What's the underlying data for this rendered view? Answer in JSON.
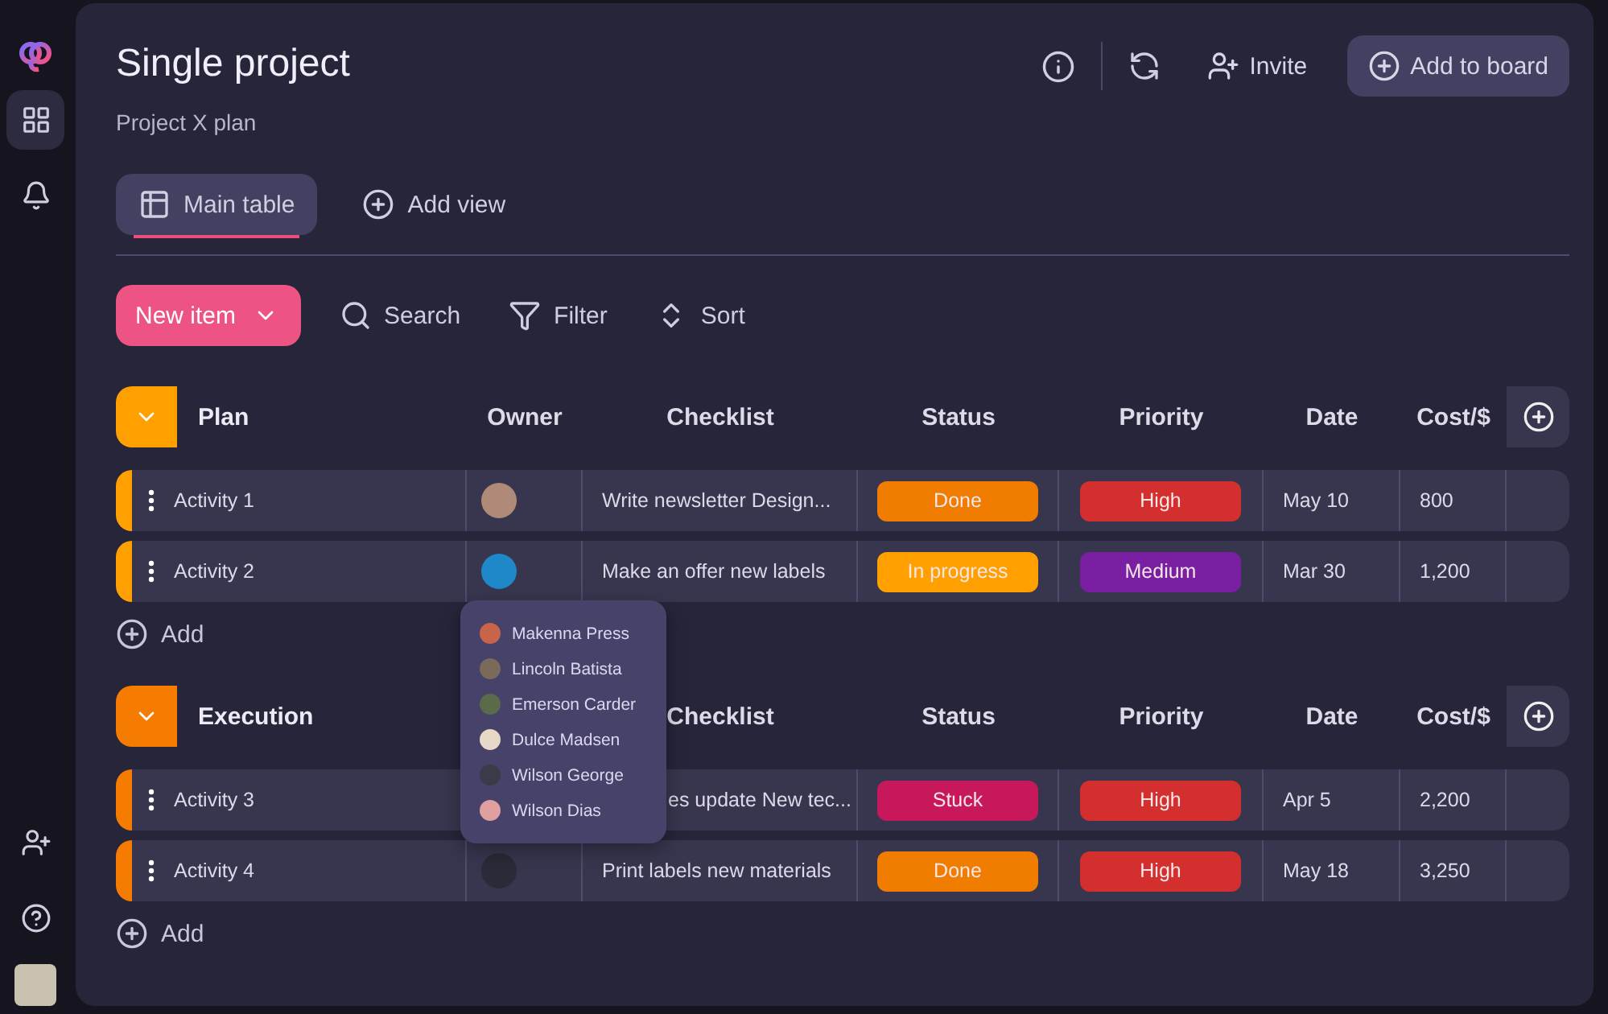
{
  "sidebar": {
    "items": [
      {
        "kind": "apps",
        "selected": true
      },
      {
        "kind": "notifications",
        "selected": false
      }
    ],
    "bottom": [
      {
        "kind": "invite"
      },
      {
        "kind": "help"
      },
      {
        "kind": "avatar",
        "color": "#c9c2b0"
      }
    ]
  },
  "header": {
    "title": "Single project",
    "subtitle": "Project X plan",
    "invite": "Invite",
    "add_to_board": "Add to board"
  },
  "views": [
    {
      "kind": "table",
      "label": "Main table",
      "selected": true
    },
    {
      "kind": "add",
      "label": "Add view",
      "selected": false
    }
  ],
  "toolbar": {
    "new_item": "New item",
    "tools": [
      {
        "kind": "search",
        "label": "Search"
      },
      {
        "kind": "filter",
        "label": "Filter"
      },
      {
        "kind": "sort",
        "label": "Sort"
      }
    ]
  },
  "groups": [
    {
      "name": "Plan",
      "color": "#ffa000",
      "add_label": "Add",
      "columns": [
        {
          "kind": "owner",
          "label": "Owner"
        },
        {
          "kind": "checklist",
          "label": "Checklist"
        },
        {
          "kind": "status",
          "label": "Status"
        },
        {
          "kind": "priority",
          "label": "Priority"
        },
        {
          "kind": "date",
          "label": "Date"
        },
        {
          "kind": "cost",
          "label": "Cost/$"
        }
      ],
      "rows": [
        {
          "name": "Activity 1",
          "owner": {
            "color": "#b08a78"
          },
          "checklist": "Write newsletter Design...",
          "status": {
            "label": "Done",
            "color": "#f07c00"
          },
          "priority": {
            "label": "High",
            "color": "#d32f2f"
          },
          "date": "May 10",
          "cost": "800"
        },
        {
          "name": "Activity 2",
          "owner": {
            "color": "#1e88c8"
          },
          "checklist": "Make an offer new labels",
          "status": {
            "label": "In progress",
            "color": "#ffa000"
          },
          "priority": {
            "label": "Medium",
            "color": "#7b1fa2"
          },
          "date": "Mar 30",
          "cost": "1,200",
          "owner_menu": [
            {
              "name": "Makenna Press",
              "color": "#c8644a"
            },
            {
              "name": "Lincoln Batista",
              "color": "#7a6a5a"
            },
            {
              "name": "Emerson Carder",
              "color": "#5a6a4a"
            },
            {
              "name": "Dulce Madsen",
              "color": "#e8d8c8"
            },
            {
              "name": "Wilson George",
              "color": "#3a3a48"
            },
            {
              "name": "Wilson Dias",
              "color": "#e0a0a0"
            }
          ]
        }
      ]
    },
    {
      "name": "Execution",
      "color": "#f57c00",
      "add_label": "Add",
      "columns": [
        {
          "kind": "checklist",
          "label": "Checklist"
        },
        {
          "kind": "status",
          "label": "Status"
        },
        {
          "kind": "priority",
          "label": "Priority"
        },
        {
          "kind": "date",
          "label": "Date"
        },
        {
          "kind": "cost",
          "label": "Cost/$"
        }
      ],
      "rows": [
        {
          "name": "Activity 3",
          "checklist": "es update New tec...",
          "checklist_covered": true,
          "status": {
            "label": "Stuck",
            "color": "#c8185c"
          },
          "priority": {
            "label": "High",
            "color": "#d32f2f"
          },
          "date": "Apr 5",
          "cost": "2,200"
        },
        {
          "name": "Activity 4",
          "owner": {
            "color": "#2a2a38"
          },
          "checklist": "Print labels new materials",
          "status": {
            "label": "Done",
            "color": "#f07c00"
          },
          "priority": {
            "label": "High",
            "color": "#d32f2f"
          },
          "date": "May 18",
          "cost": "3,250"
        }
      ]
    }
  ]
}
